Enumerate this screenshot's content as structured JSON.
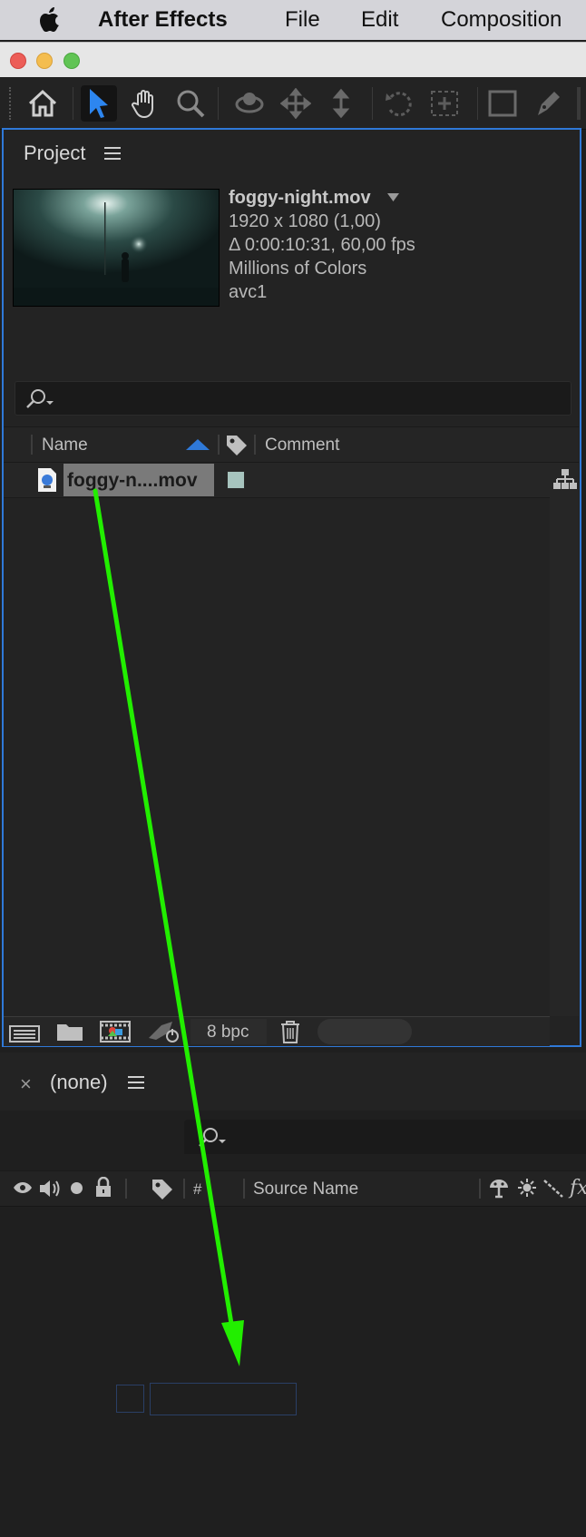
{
  "menubar": {
    "items": [
      "After Effects",
      "File",
      "Edit",
      "Composition"
    ]
  },
  "project": {
    "panel_title": "Project",
    "footage": {
      "name": "foggy-night.mov",
      "resolution": "1920 x 1080 (1,00)",
      "duration": "Δ 0:00:10:31, 60,00 fps",
      "colors": "Millions of Colors",
      "codec": "avc1"
    },
    "columns": {
      "name": "Name",
      "comment": "Comment"
    },
    "items": [
      {
        "name": "foggy-n....mov",
        "label_color": "#a7c4be"
      }
    ],
    "bpc": "8 bpc"
  },
  "timeline": {
    "tab_label": "(none)",
    "columns": {
      "number": "#",
      "source_name": "Source Name",
      "fx": "fx"
    }
  },
  "annotation": {
    "arrow_color": "#22ee00"
  },
  "colors": {
    "accent_blue": "#2f79d8",
    "selection": "#7a7a7a"
  }
}
